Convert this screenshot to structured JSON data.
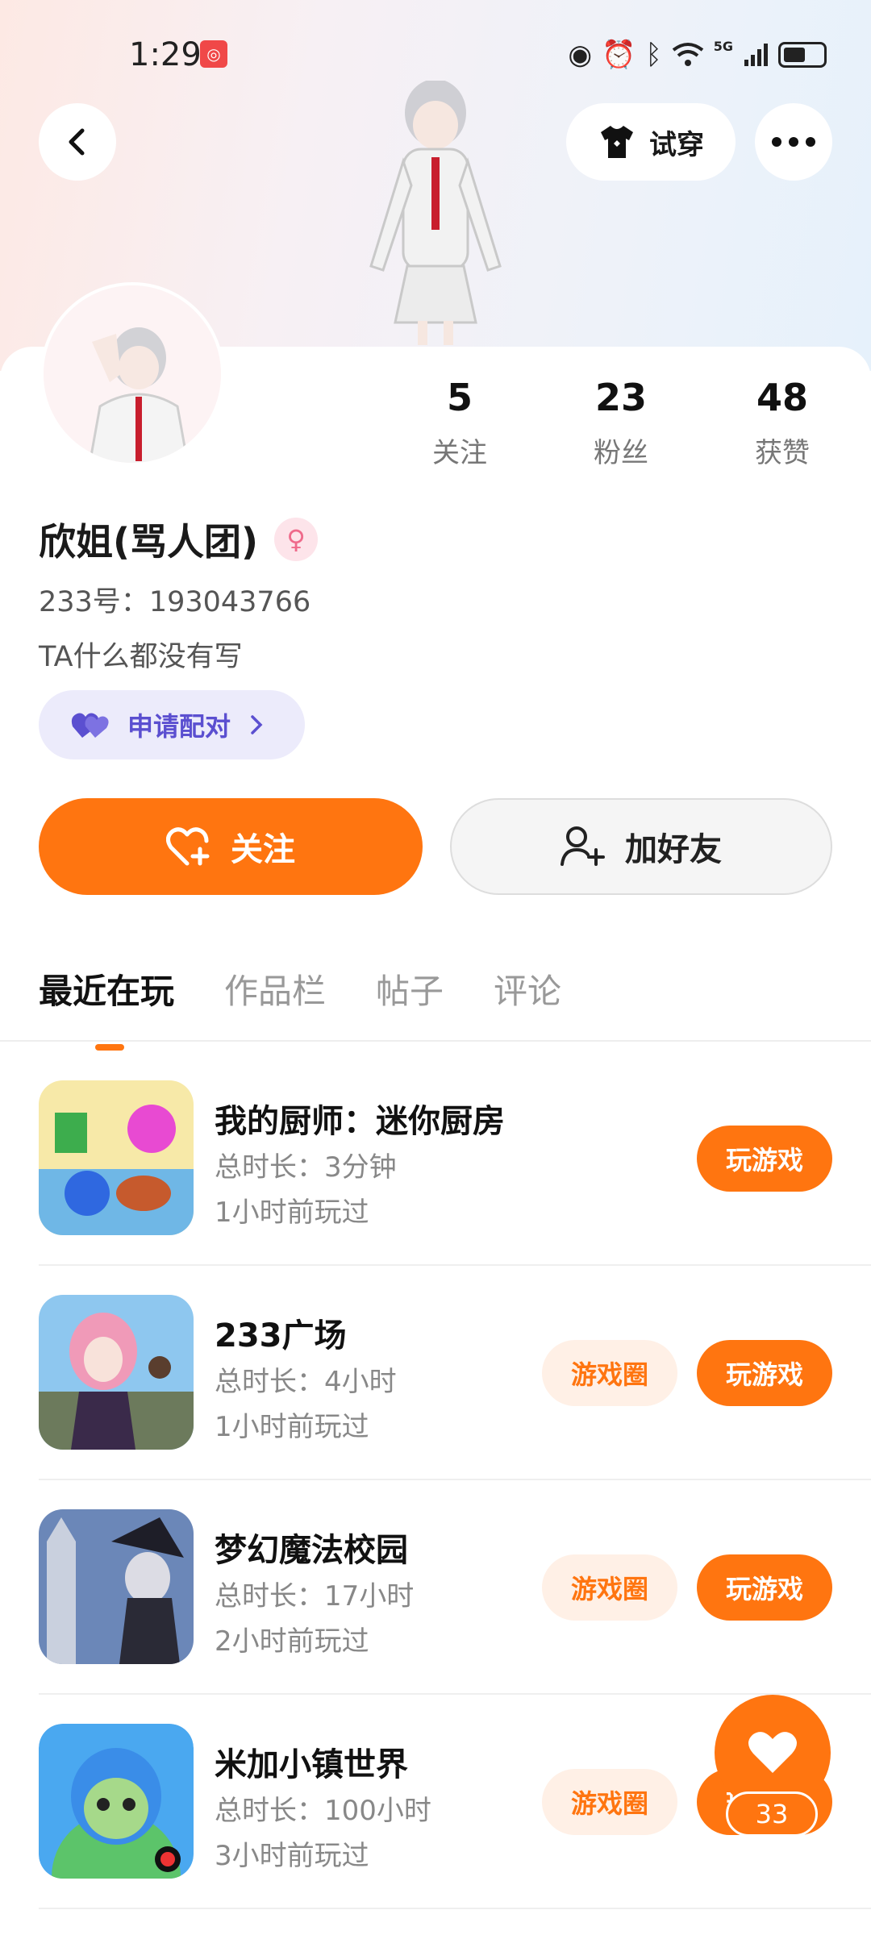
{
  "status_bar": {
    "time": "1:29",
    "network": "5G",
    "icons": [
      "eye-icon",
      "alarm-icon",
      "bluetooth-icon",
      "wifi-icon",
      "signal-icon",
      "battery-icon"
    ]
  },
  "header": {
    "back_icon": "chevron-left-icon",
    "tryon_label": "试穿",
    "more_icon": "ellipsis-icon"
  },
  "profile": {
    "name": "欣姐(骂人团)",
    "uid_label": "233号：",
    "uid_value": "193043766",
    "bio": "TA什么都没有写",
    "gender_symbol": "♀",
    "match_label": "申请配对"
  },
  "stats": [
    {
      "value": "5",
      "label": "关注"
    },
    {
      "value": "23",
      "label": "粉丝"
    },
    {
      "value": "48",
      "label": "获赞"
    }
  ],
  "actions": {
    "follow_label": "关注",
    "add_friend_label": "加好友"
  },
  "tabs": [
    {
      "label": "最近在玩",
      "active": true
    },
    {
      "label": "作品栏",
      "active": false
    },
    {
      "label": "帖子",
      "active": false
    },
    {
      "label": "评论",
      "active": false
    }
  ],
  "games": [
    {
      "title": "我的厨师：迷你厨房",
      "duration_label": "总时长：",
      "duration": "3分钟",
      "last_played": "1小时前玩过",
      "has_circle": false,
      "play_label": "玩游戏",
      "circle_label": ""
    },
    {
      "title": "233广场",
      "duration_label": "总时长：",
      "duration": "4小时",
      "last_played": "1小时前玩过",
      "has_circle": true,
      "play_label": "玩游戏",
      "circle_label": "游戏圈"
    },
    {
      "title": "梦幻魔法校园",
      "duration_label": "总时长：",
      "duration": "17小时",
      "last_played": "2小时前玩过",
      "has_circle": true,
      "play_label": "玩游戏",
      "circle_label": "游戏圈"
    },
    {
      "title": "米加小镇世界",
      "duration_label": "总时长：",
      "duration": "100小时",
      "last_played": "3小时前玩过",
      "has_circle": true,
      "play_label": "玩游戏",
      "circle_label": "游戏圈"
    }
  ],
  "fab": {
    "count": "33",
    "icon": "heart-icon"
  },
  "colors": {
    "accent": "#ff7510",
    "match": "#5b4fd0",
    "circle_bg": "#fff0e6"
  }
}
